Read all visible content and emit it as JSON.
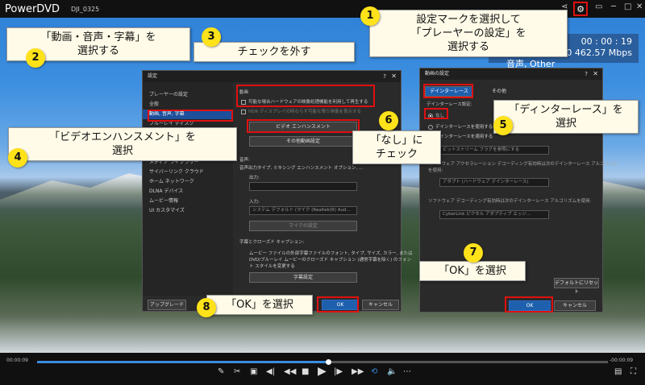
{
  "app": {
    "title": "PowerDVD",
    "file": "DJI_0325"
  },
  "time_overlay": {
    "time": "00 : 00 : 19",
    "bitrate": "60 462.57 Mbps",
    "audio": "音声, Other"
  },
  "left_dialog": {
    "title": "設定",
    "sidebar": [
      "プレーヤーの設定",
      "全般",
      "動画, 音声, 字幕",
      "ブルーレイ ディスク",
      "",
      "",
      "",
      "メディア ライブラリー",
      "サイバーリンク クラウド",
      "ホーム ネットワーク",
      "DLNA デバイス",
      "ムービー情報",
      "UI カスタマイズ"
    ],
    "video_header": "動画",
    "hw_check": "可能な場合ハードウェアの映像処理機能を利用して再生する",
    "hdr_check": "HDR ディスプレイの時ならず可能な限り映像を表示する",
    "enhance_button": "ビデオ エンハンスメント",
    "other_button": "その他動画設定",
    "audio_header": "音声:",
    "audio_desc": "音声出力タイプ, ミキシング エンハンスメント オプション, ...",
    "output_label": "出力:",
    "input_label": "入力:",
    "input_value": "システム デフォルト (マイク (Realtek(R) Aud...",
    "mic_button": "マイクの設定",
    "sub_header": "字幕とクローズド キャプション:",
    "sub_desc_1": "ムービー ファイルの外部字幕ファイルのフォント, タイプ, サイズ, カラー, または",
    "sub_desc_2": "DVD/ブルーレイ ムービーのクローズド キャプション (通常字幕を除く) のフォン",
    "sub_desc_3": "ト スタイルを変更する",
    "sub_button": "字幕設定",
    "upgrade": "アップグレード",
    "ok": "OK",
    "cancel": "キャンセル"
  },
  "right_dialog": {
    "title": "動画の設定",
    "tab_deint": "デインターレース",
    "tab_other": "その他",
    "deint_label": "デインターレース設定:",
    "opt_none": "なし",
    "opt_use": "デインターレースを使用する",
    "opt_apply": "デインターレースを適用する",
    "field1": "ビットストリーム フラグを参照にする",
    "hw_desc_1": "ハードウェア アクセラレーション デコーディング有効時は次のデインターレース アルゴリズム",
    "hw_desc_2": "を使用:",
    "field2": "アダプト (ハードウェア デインターレース)",
    "sw_desc": "ソフトウェア デコーディング有効時は次のデインターレース アルゴリズムを使用:",
    "field3": "CyberLink ピクセル アダプティブ エッジ...",
    "reset": "デフォルトにリセット",
    "ok": "OK",
    "cancel": "キャンセル"
  },
  "callouts": {
    "c1": "設定マークを選択して\n「プレーヤーの設定」を\n選択する",
    "c2": "「動画・音声・字幕」を\n選択する",
    "c3": "チェックを外す",
    "c4": "「ビデオエンハンスメント」を\n選択",
    "c5": "「ディンターレース」を\n選択",
    "c6": "「なし」に\nチェック",
    "c7": "「OK」を選択",
    "c8": "「OK」を選択"
  },
  "steps": [
    "1",
    "2",
    "3",
    "4",
    "5",
    "6",
    "7",
    "8"
  ],
  "controls": {
    "time_left": "00:00:09",
    "time_right": "-00:00:09",
    "progress": 0.51
  },
  "colors": {
    "accent": "#e01010",
    "callout_badge": "#ffe21a",
    "selected": "#1d4f9a"
  }
}
